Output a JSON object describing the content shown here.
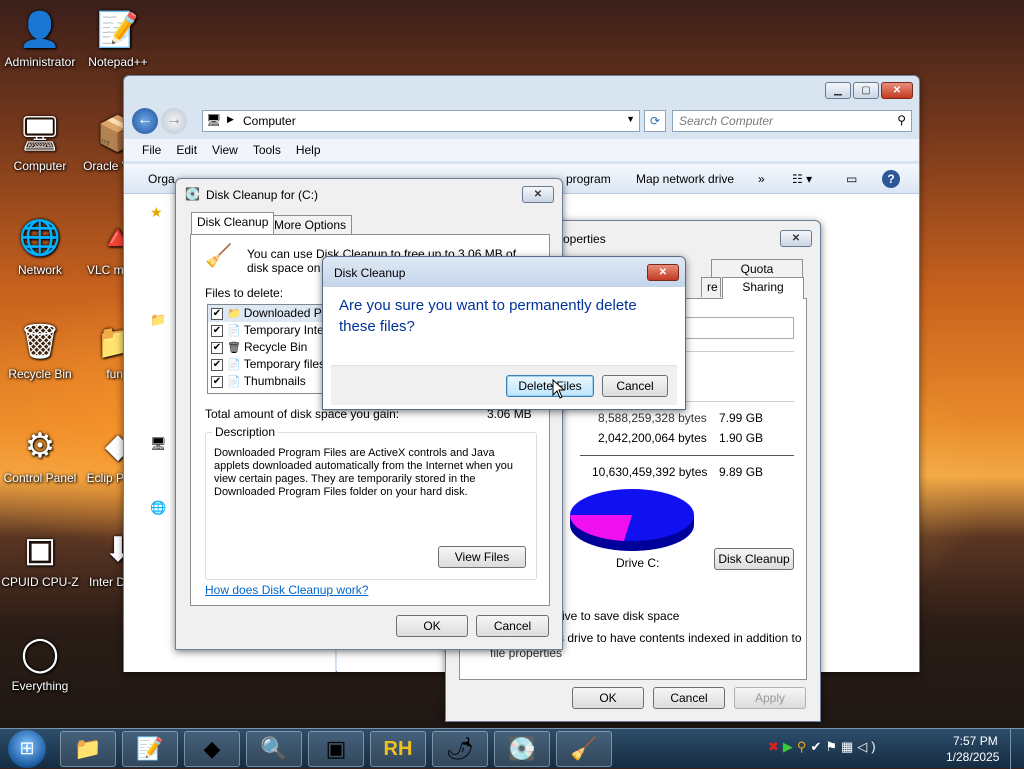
{
  "desktop_icons": [
    {
      "label": "Administrator",
      "glyph": "👤"
    },
    {
      "label": "Notepad++",
      "glyph": "📝"
    },
    {
      "label": "Computer",
      "glyph": "🖥"
    },
    {
      "label": "Oracle Virtua",
      "glyph": "📦"
    },
    {
      "label": "Network",
      "glyph": "🌐"
    },
    {
      "label": "VLC m play",
      "glyph": "🔺"
    },
    {
      "label": "Recycle Bin",
      "glyph": "🗑"
    },
    {
      "label": "funn",
      "glyph": "📁"
    },
    {
      "label": "Control Panel",
      "glyph": "⚙"
    },
    {
      "label": "Eclip Plasm",
      "glyph": "◆"
    },
    {
      "label": "CPUID CPU-Z",
      "glyph": "▣"
    },
    {
      "label": "Inter Down",
      "glyph": "⬇"
    },
    {
      "label": "Everything",
      "glyph": "◯"
    }
  ],
  "explorer": {
    "address": "Computer",
    "search_placeholder": "Search Computer",
    "menu": [
      "File",
      "Edit",
      "View",
      "Tools",
      "Help"
    ],
    "toolbar": {
      "organize": "Orga",
      "uninstall": "program",
      "map_drive": "Map network drive",
      "more": "»"
    }
  },
  "properties": {
    "title": "operties",
    "tabs": [
      "Quota",
      "Sharing",
      "re"
    ],
    "used_bytes": "8,588,259,328 bytes",
    "used_gb": "7.99 GB",
    "free_bytes": "2,042,200,064 bytes",
    "free_gb": "1.90 GB",
    "capacity_bytes": "10,630,459,392 bytes",
    "capacity_gb": "9.89 GB",
    "drive_label": "Drive C:",
    "disk_cleanup_btn": "Disk Cleanup",
    "compress_text": "rive to save disk space",
    "index_text": "s drive to have contents indexed in addition to",
    "index_text2": "file properties",
    "ok": "OK",
    "cancel": "Cancel",
    "apply": "Apply",
    "colors": {
      "used": "#1010f0",
      "free": "#f010f0"
    }
  },
  "cleanup": {
    "title": "Disk Cleanup for  (C:)",
    "tabs": [
      "Disk Cleanup",
      "More Options"
    ],
    "intro": "You can use Disk Cleanup to free up to 3.06 MB of disk space on  (C:).",
    "files_label": "Files to delete:",
    "files": [
      {
        "name": "Downloaded Pro",
        "icon": "📁"
      },
      {
        "name": "Temporary Intern",
        "icon": "📄"
      },
      {
        "name": "Recycle Bin",
        "icon": "🗑"
      },
      {
        "name": "Temporary files",
        "icon": "📄"
      },
      {
        "name": "Thumbnails",
        "icon": "📄"
      }
    ],
    "total_label": "Total amount of disk space you gain:",
    "total_value": "3.06 MB",
    "description_label": "Description",
    "description": "Downloaded Program Files are ActiveX controls and Java applets downloaded automatically from the Internet when you view certain pages. They are temporarily stored in the Downloaded Program Files folder on your hard disk.",
    "view_files": "View Files",
    "help_link": "How does Disk Cleanup work?",
    "ok": "OK",
    "cancel": "Cancel"
  },
  "confirm": {
    "title": "Disk Cleanup",
    "message": "Are you sure you want to permanently delete these files?",
    "delete_btn": "Delete Files",
    "cancel_btn": "Cancel"
  },
  "taskbar": {
    "apps": [
      "📁",
      "📝",
      "◆",
      "🔍",
      "▣",
      "RH",
      "🌶",
      "💽",
      "🧹"
    ],
    "time": "7:57 PM",
    "date": "1/28/2025"
  }
}
